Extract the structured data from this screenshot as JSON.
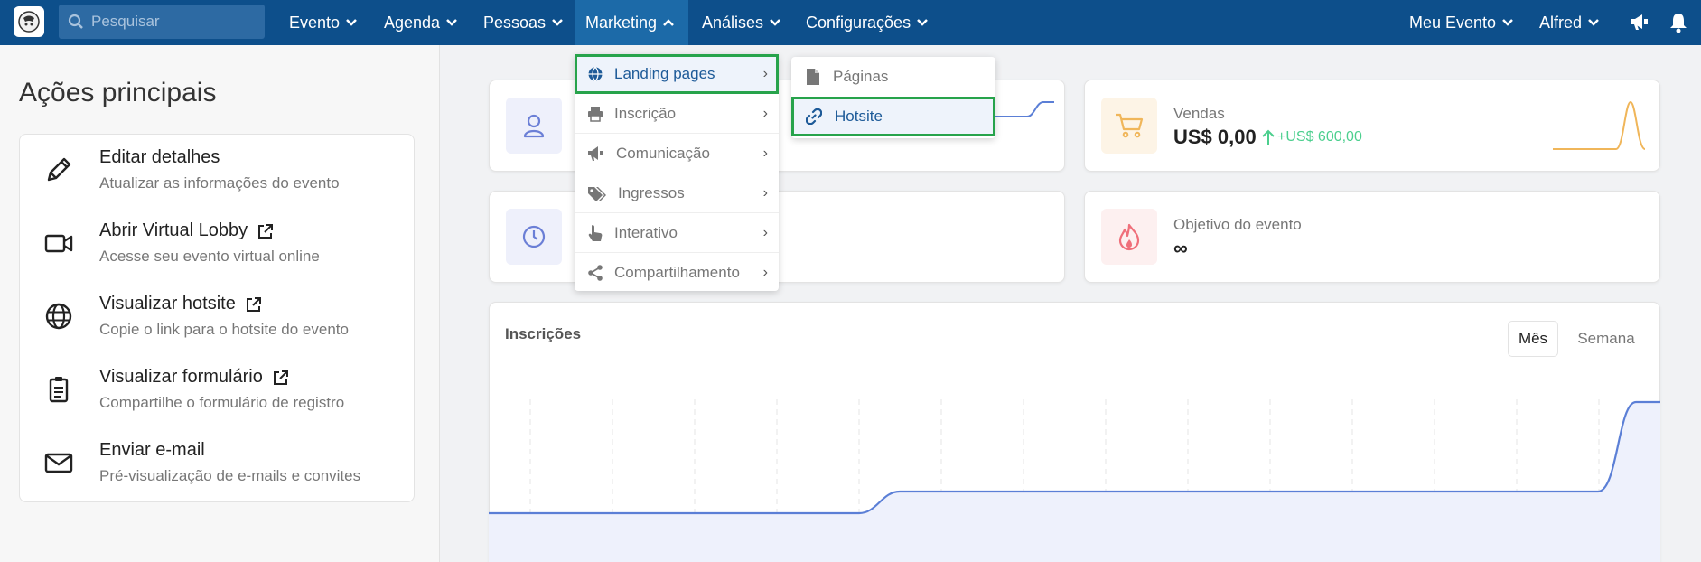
{
  "nav": {
    "search_placeholder": "Pesquisar",
    "items": [
      {
        "label": "Evento"
      },
      {
        "label": "Agenda"
      },
      {
        "label": "Pessoas"
      },
      {
        "label": "Marketing"
      },
      {
        "label": "Análises"
      },
      {
        "label": "Configurações"
      }
    ],
    "right": [
      {
        "label": "Meu Evento"
      },
      {
        "label": "Alfred"
      }
    ]
  },
  "left": {
    "title": "Ações principais",
    "actions": [
      {
        "title": "Editar detalhes",
        "subtitle": "Atualizar as informações do evento",
        "icon": "pencil-icon",
        "external": false
      },
      {
        "title": "Abrir Virtual Lobby",
        "subtitle": "Acesse seu evento virtual online",
        "icon": "video-camera-icon",
        "external": true
      },
      {
        "title": "Visualizar hotsite",
        "subtitle": "Copie o link para o hotsite do evento",
        "icon": "globe-icon",
        "external": true
      },
      {
        "title": "Visualizar formulário",
        "subtitle": "Compartilhe o formulário de registro",
        "icon": "clipboard-icon",
        "external": true
      },
      {
        "title": "Enviar e-mail",
        "subtitle": "Pré-visualização de e-mails e convites",
        "icon": "envelope-icon",
        "external": false
      }
    ]
  },
  "cards": {
    "sales": {
      "label": "Vendas",
      "value": "US$ 0,00",
      "delta": "+US$ 600,00"
    },
    "goal": {
      "label": "Objetivo do evento",
      "value": "∞"
    }
  },
  "registrations": {
    "title": "Inscrições",
    "tabs": [
      "Mês",
      "Semana"
    ],
    "active_tab": "Mês"
  },
  "marketing_menu": {
    "items": [
      {
        "label": "Landing pages",
        "icon": "globe-icon"
      },
      {
        "label": "Inscrição",
        "icon": "printer-icon"
      },
      {
        "label": "Comunicação",
        "icon": "megaphone-icon"
      },
      {
        "label": "Ingressos",
        "icon": "tags-icon"
      },
      {
        "label": "Interativo",
        "icon": "pointer-hand-icon"
      },
      {
        "label": "Compartilhamento",
        "icon": "share-icon"
      }
    ],
    "submenu": [
      {
        "label": "Páginas",
        "icon": "file-icon"
      },
      {
        "label": "Hotsite",
        "icon": "link-icon"
      }
    ]
  },
  "colors": {
    "nav_bg": "#0d4f8b",
    "accent": "#1d5a98",
    "highlight_outline": "#27a34b",
    "chart_line": "#5b7fd6",
    "positive": "#4ccf8e"
  }
}
